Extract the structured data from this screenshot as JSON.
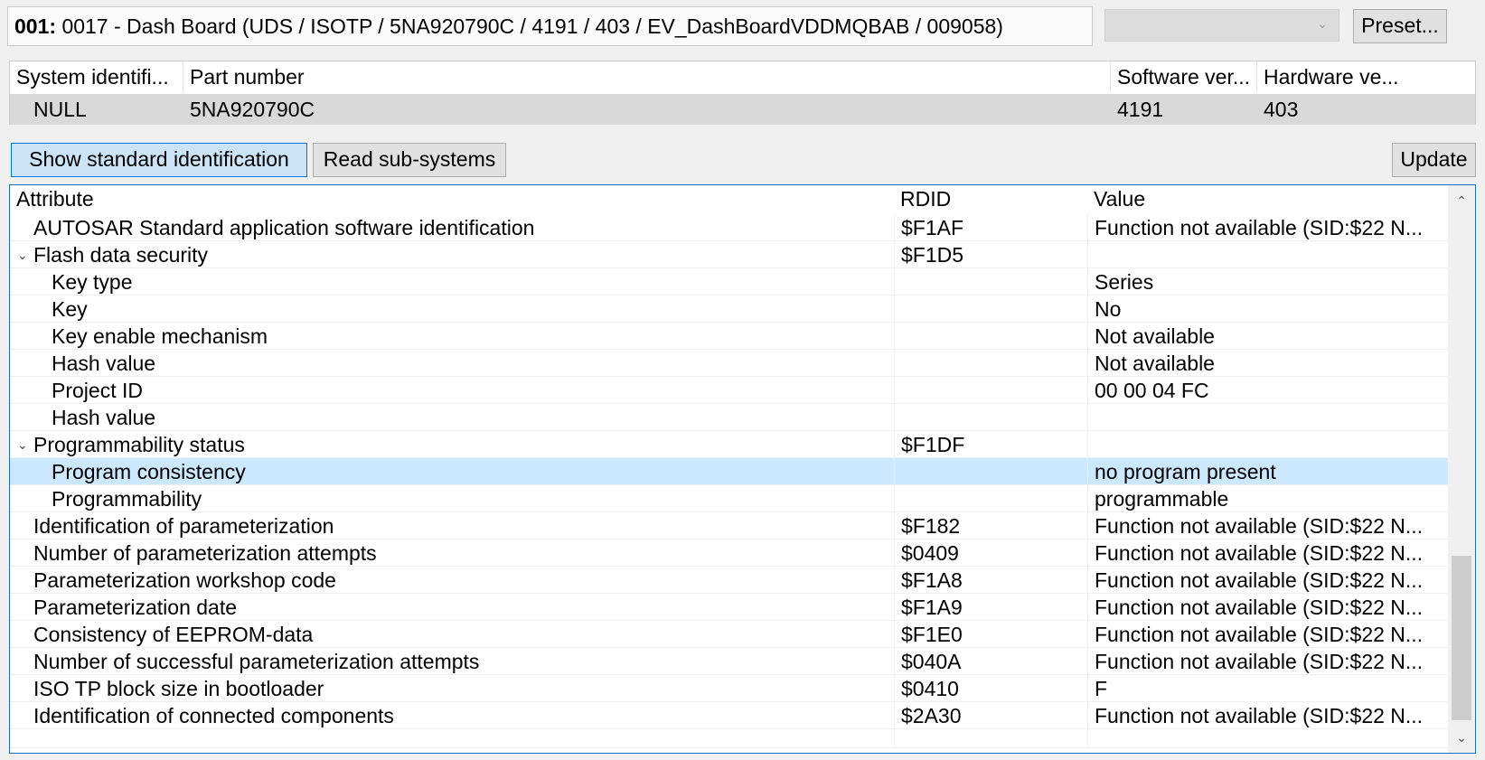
{
  "header": {
    "address": "001:",
    "title": "0017 - Dash Board  (UDS / ISOTP / 5NA920790C / 4191 / 403 / EV_DashBoardVDDMQBAB / 009058)",
    "combo_value": "",
    "preset_label": "Preset..."
  },
  "subsystems": {
    "columns": [
      "System identifi...",
      "Part number",
      "Software ver...",
      "Hardware ve..."
    ],
    "rows": [
      {
        "system": "NULL",
        "part": "5NA920790C",
        "software": "4191",
        "hardware": "403"
      }
    ]
  },
  "buttons": {
    "show_standard": "Show standard identification",
    "read_subsystems": "Read sub-systems",
    "update": "Update"
  },
  "grid": {
    "columns": [
      "Attribute",
      "RDID",
      "Value"
    ],
    "rows": [
      {
        "attr": "AUTOSAR Standard application software identification",
        "rdid": "$F1AF",
        "value": "Function not available (SID:$22 N...",
        "level": 0,
        "expander": ""
      },
      {
        "attr": "Flash data security",
        "rdid": "$F1D5",
        "value": "",
        "level": 0,
        "expander": "⌄"
      },
      {
        "attr": "Key type",
        "rdid": "",
        "value": "Series",
        "level": 1,
        "expander": ""
      },
      {
        "attr": "Key",
        "rdid": "",
        "value": "No",
        "level": 1,
        "expander": ""
      },
      {
        "attr": "Key enable mechanism",
        "rdid": "",
        "value": "Not available",
        "level": 1,
        "expander": ""
      },
      {
        "attr": "Hash value",
        "rdid": "",
        "value": "Not available",
        "level": 1,
        "expander": ""
      },
      {
        "attr": "Project ID",
        "rdid": "",
        "value": "00 00 04 FC",
        "level": 1,
        "expander": ""
      },
      {
        "attr": "Hash value",
        "rdid": "",
        "value": "",
        "level": 1,
        "expander": ""
      },
      {
        "attr": "Programmability status",
        "rdid": "$F1DF",
        "value": "",
        "level": 0,
        "expander": "⌄"
      },
      {
        "attr": "Program consistency",
        "rdid": "",
        "value": "no program present",
        "level": 1,
        "expander": "",
        "selected": true
      },
      {
        "attr": "Programmability",
        "rdid": "",
        "value": "programmable",
        "level": 1,
        "expander": ""
      },
      {
        "attr": "Identification of parameterization",
        "rdid": "$F182",
        "value": "Function not available (SID:$22 N...",
        "level": 0,
        "expander": ""
      },
      {
        "attr": "Number of parameterization attempts",
        "rdid": "$0409",
        "value": "Function not available (SID:$22 N...",
        "level": 0,
        "expander": ""
      },
      {
        "attr": "Parameterization workshop code",
        "rdid": "$F1A8",
        "value": "Function not available (SID:$22 N...",
        "level": 0,
        "expander": ""
      },
      {
        "attr": "Parameterization date",
        "rdid": "$F1A9",
        "value": "Function not available (SID:$22 N...",
        "level": 0,
        "expander": ""
      },
      {
        "attr": "Consistency of EEPROM-data",
        "rdid": "$F1E0",
        "value": "Function not available (SID:$22 N...",
        "level": 0,
        "expander": ""
      },
      {
        "attr": "Number of successful parameterization attempts",
        "rdid": "$040A",
        "value": "Function not available (SID:$22 N...",
        "level": 0,
        "expander": ""
      },
      {
        "attr": "ISO TP block size in bootloader",
        "rdid": "$0410",
        "value": "F",
        "level": 0,
        "expander": ""
      },
      {
        "attr": "Identification of connected components",
        "rdid": "$2A30",
        "value": "Function not available (SID:$22 N...",
        "level": 0,
        "expander": ""
      }
    ]
  },
  "icons": {
    "combo_arrow": "chevron-down-icon",
    "scroll_up": "scroll-up-arrow-icon",
    "scroll_down": "scroll-down-arrow-icon",
    "expand": "chevron-expanded-icon"
  },
  "colors": {
    "selection": "#cce8ff",
    "focus_border": "#1e6fbf",
    "button_active": "#cce4f7"
  }
}
